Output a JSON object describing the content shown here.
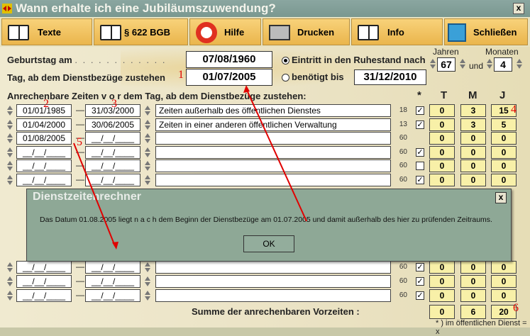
{
  "window": {
    "title": "Wann erhalte ich eine Jubiläumszuwendung?",
    "close": "x"
  },
  "toolbar": {
    "buttons": [
      {
        "label": "Texte",
        "icon": "book-icon"
      },
      {
        "label": "§ 622 BGB",
        "icon": "book-icon"
      },
      {
        "label": "Hilfe",
        "icon": "lifebuoy-icon"
      },
      {
        "label": "Drucken",
        "icon": "printer-icon"
      },
      {
        "label": "Info",
        "icon": "book-icon"
      },
      {
        "label": "Schließen",
        "icon": "exit-door-icon"
      }
    ]
  },
  "form": {
    "birthday_label": "Geburtstag am",
    "birthday_value": "07/08/1960",
    "dienstbezuege_label": "Tag, ab dem Dienstbezüge zustehen",
    "dienstbezuege_value": "01/07/2005",
    "radio_ruhestand": "Eintritt in den Ruhestand nach",
    "radio_benoetigt": "benötigt bis",
    "benoetigt_value": "31/12/2010",
    "jahren_label": "Jahren",
    "jahren_value": "67",
    "und": "und",
    "monaten_label": "Monaten",
    "monaten_value": "4"
  },
  "table": {
    "heading": "Anrechenbare Zeiten   v o r   dem Tag, ab dem Dienstbezüge zustehen:",
    "col_star": "*",
    "col_t": "T",
    "col_m": "M",
    "col_j": "J",
    "rows": [
      {
        "from": "01/01/1985",
        "to": "31/03/2000",
        "desc": "Zeiten außerhalb des öffentlichen Dienstes",
        "pct": "18",
        "chk": true,
        "t": "0",
        "m": "3",
        "j": "15"
      },
      {
        "from": "01/04/2000",
        "to": "30/06/2005",
        "desc": "Zeiten in einer anderen öffentlichen Verwaltung",
        "pct": "13",
        "chk": true,
        "t": "0",
        "m": "3",
        "j": "5"
      },
      {
        "from": "01/08/2005",
        "to": "__/__/____",
        "desc": "",
        "pct": "60",
        "chk": null,
        "t": "0",
        "m": "0",
        "j": "0"
      },
      {
        "from": "__/__/____",
        "to": "__/__/____",
        "desc": "",
        "pct": "60",
        "chk": true,
        "t": "0",
        "m": "0",
        "j": "0"
      },
      {
        "from": "__/__/____",
        "to": "__/__/____",
        "desc": "",
        "pct": "60",
        "chk": false,
        "t": "0",
        "m": "0",
        "j": "0"
      },
      {
        "from": "__/__/____",
        "to": "__/__/____",
        "desc": "",
        "pct": "60",
        "chk": true,
        "t": "0",
        "m": "0",
        "j": "0"
      }
    ],
    "bottom_rows": [
      {
        "from": "__/__/____",
        "to": "__/__/____",
        "pct": "60",
        "chk": true,
        "t": "0",
        "m": "0",
        "j": "0"
      },
      {
        "from": "__/__/____",
        "to": "__/__/____",
        "pct": "60",
        "chk": true,
        "t": "0",
        "m": "0",
        "j": "0"
      },
      {
        "from": "__/__/____",
        "to": "__/__/____",
        "pct": "60",
        "chk": true,
        "t": "0",
        "m": "0",
        "j": "0"
      }
    ],
    "dash": "—"
  },
  "summary": {
    "label": "Summe der anrechenbaren Vorzeiten :",
    "t": "0",
    "m": "6",
    "j": "20",
    "note": "* ) im öffentlichen Dienst = x"
  },
  "dialog": {
    "title": "Dienstzeitenrechner",
    "message": "Das Datum 01.08.2005 liegt    n a c h    dem Beginn der Dienstbezüge am 01.07.2005 und damit außerhalb des hier zu prüfenden Zeitraums.",
    "ok": "OK",
    "close": "x"
  },
  "annotations": [
    "1",
    "2",
    "3",
    "4",
    "5",
    "6"
  ]
}
